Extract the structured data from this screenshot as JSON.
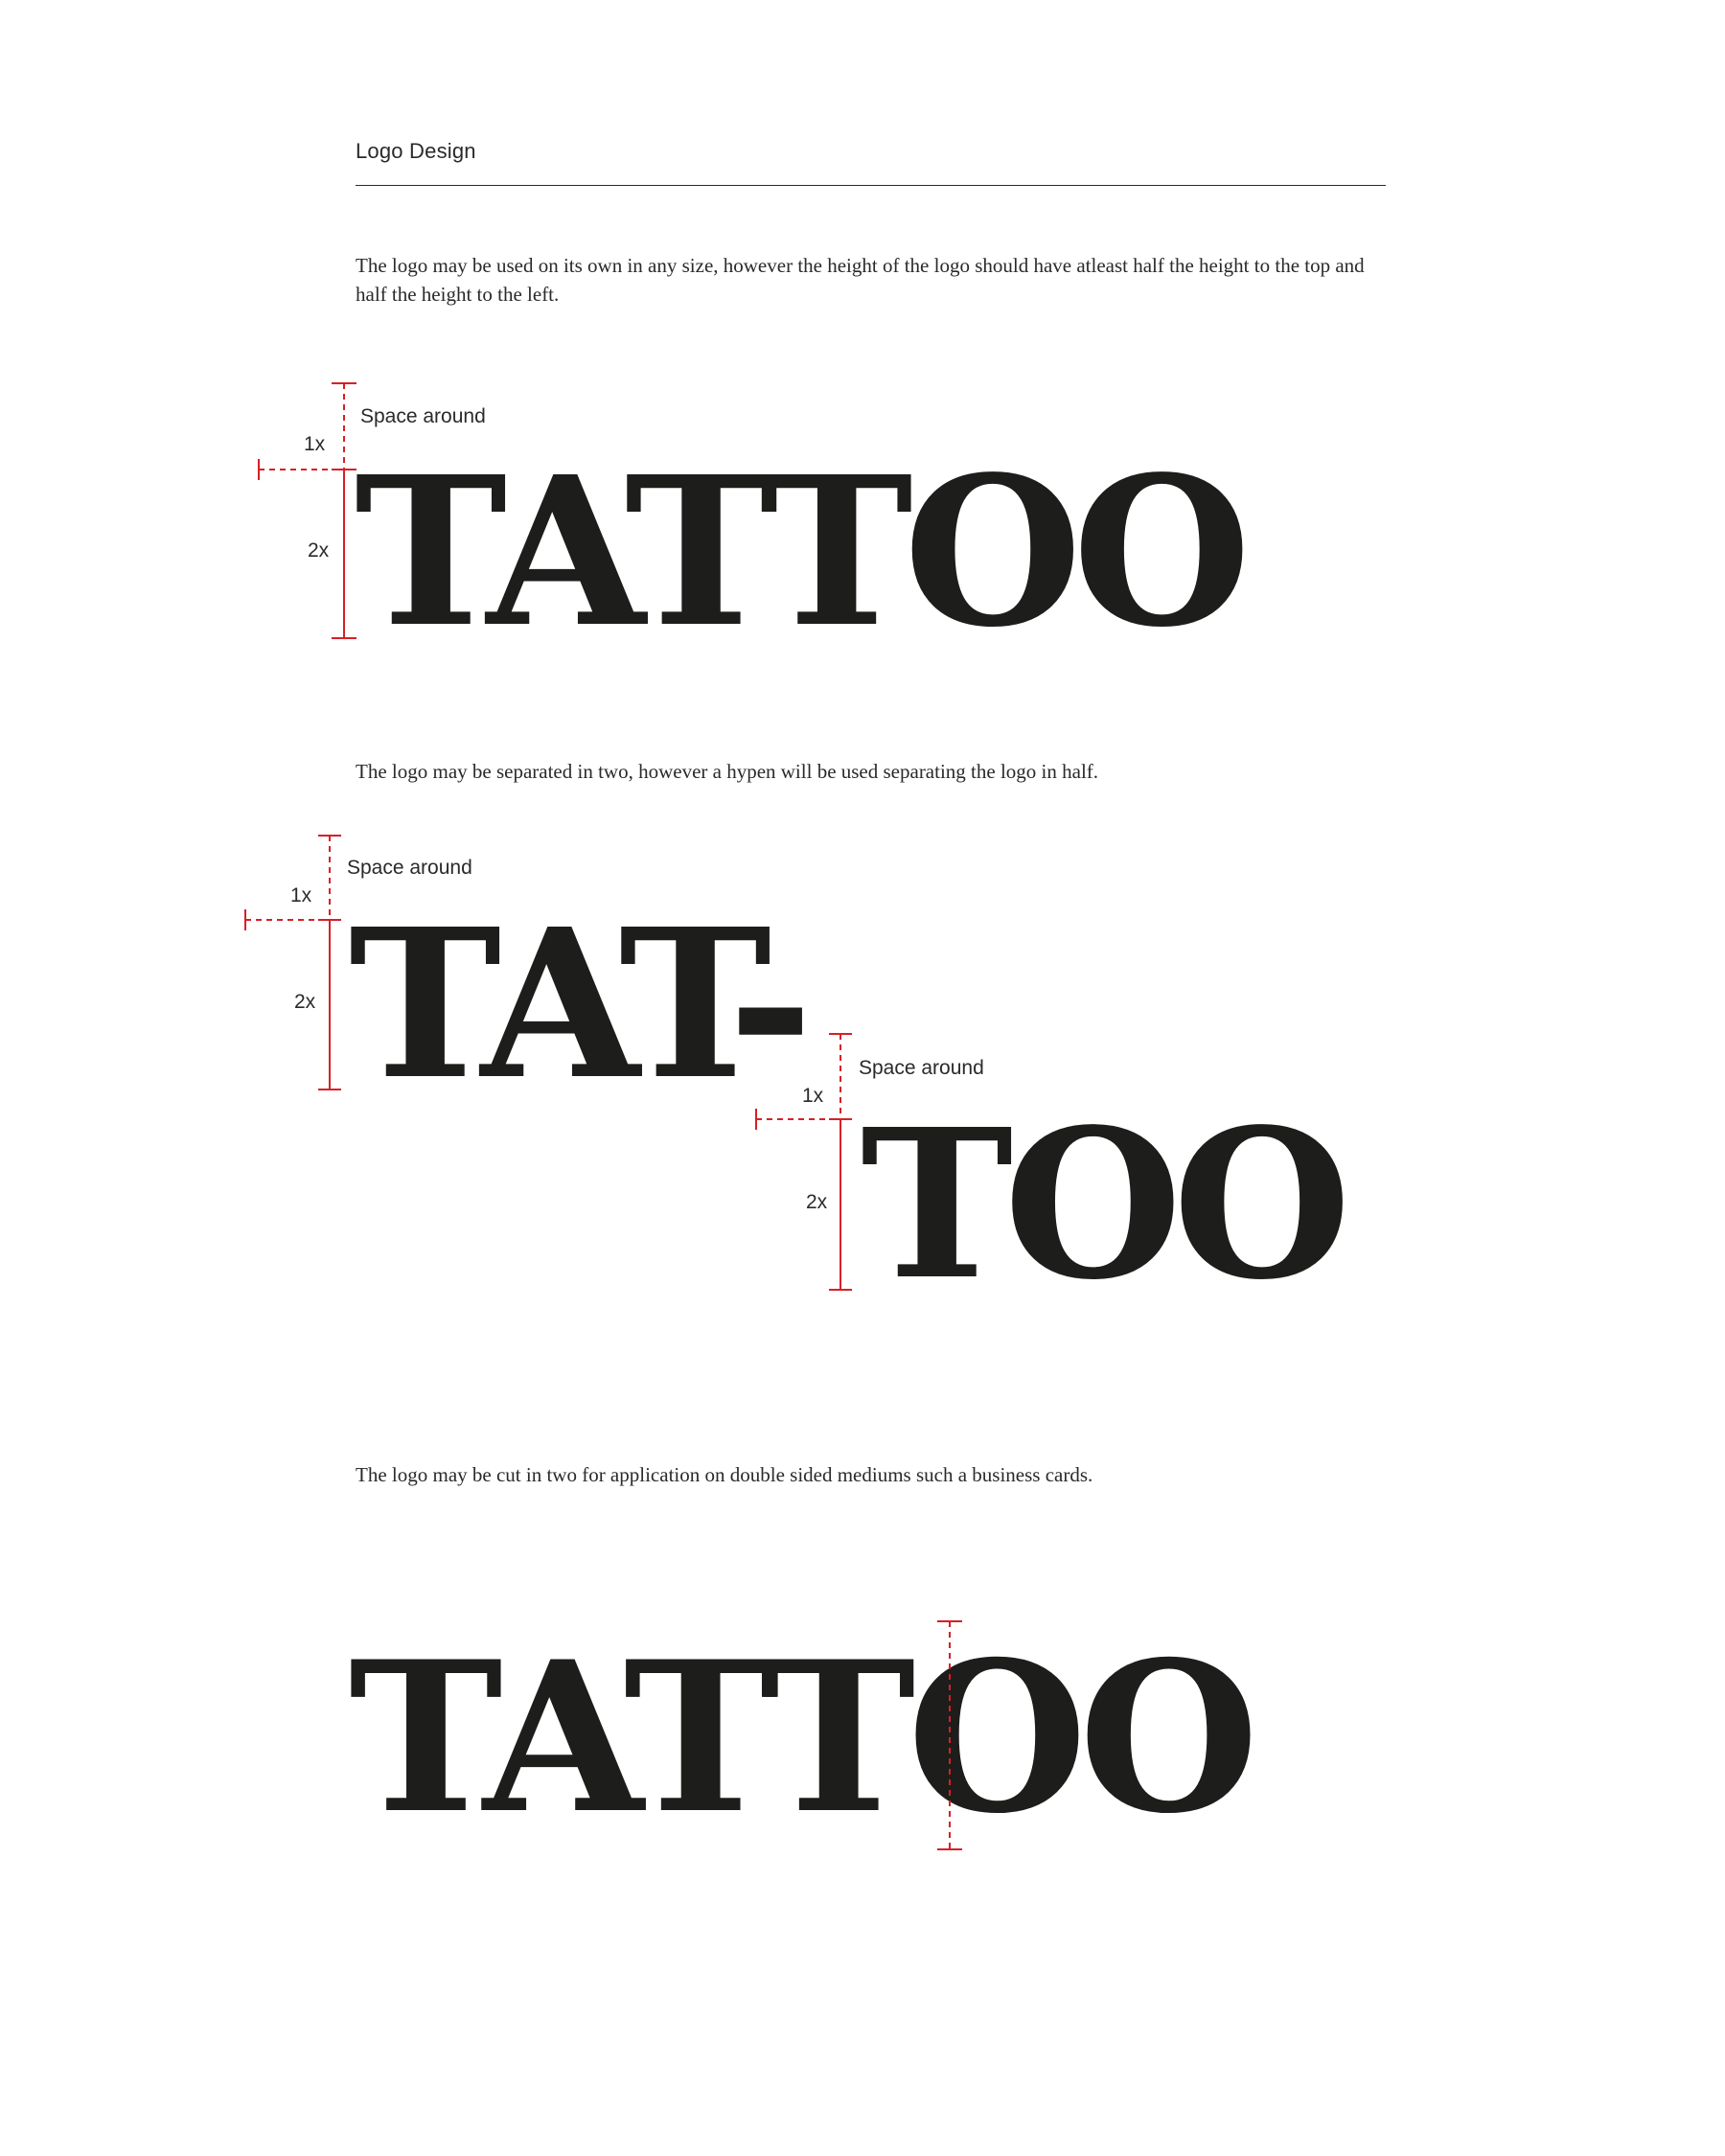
{
  "header": {
    "title": "Logo Design"
  },
  "paragraphs": {
    "intro": "The logo may be used on its own in any size, however the height of the logo should have atleast half the height to the top and half the height to the left.",
    "split": "The logo may be separated in two, however a hypen will be used separating the logo in half.",
    "cut": "The logo may be cut in two for application on double sided mediums such a business cards."
  },
  "logo": {
    "full": "TATTOO",
    "part1": "TAT-",
    "part2": "TOO"
  },
  "annotations": {
    "space_around": "Space around",
    "one_x": "1x",
    "two_x": "2x"
  },
  "colors": {
    "text": "#1d1d1b",
    "guide": "#d62027",
    "rule": "#2a2a2a"
  }
}
